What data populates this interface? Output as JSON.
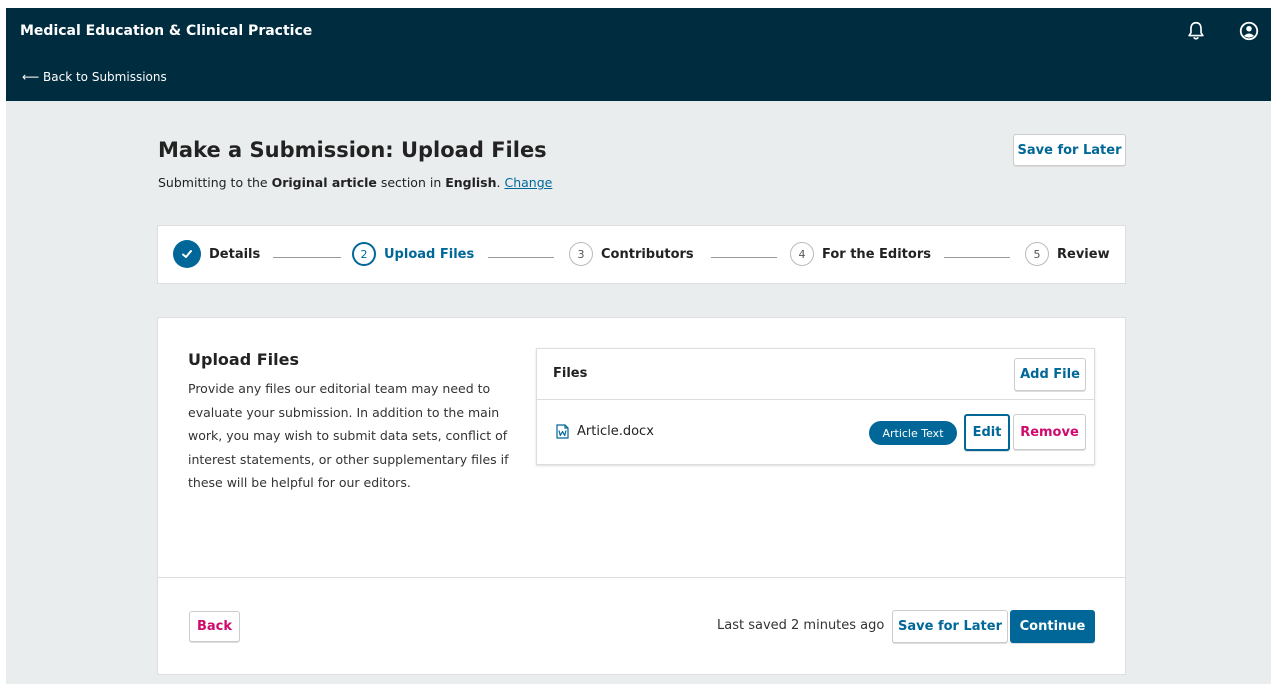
{
  "header": {
    "site_title": "Medical Education & Clinical Practice",
    "back_link": "⟵ Back to Submissions",
    "icons": [
      "bell-icon",
      "user-account-icon"
    ]
  },
  "page": {
    "title": "Make a Submission: Upload Files",
    "save_later": "Save for Later",
    "subtitle_pre": "Submitting to the ",
    "section": "Original article",
    "subtitle_mid": " section in ",
    "language": "English",
    "subtitle_post": ". ",
    "change_link": "Change"
  },
  "steps": [
    {
      "number": "",
      "label": "Details",
      "state": "complete"
    },
    {
      "number": "2",
      "label": "Upload Files",
      "state": "active"
    },
    {
      "number": "3",
      "label": "Contributors",
      "state": "pending"
    },
    {
      "number": "4",
      "label": "For the Editors",
      "state": "pending"
    },
    {
      "number": "5",
      "label": "Review",
      "state": "pending"
    }
  ],
  "upload": {
    "title": "Upload Files",
    "description": "Provide any files our editorial team may need to evaluate your submission. In addition to the main work, you may wish to submit data sets, conflict of interest statements, or other supplementary files if these will be helpful for our editors."
  },
  "files": {
    "title": "Files",
    "add_file": "Add File",
    "items": [
      {
        "name": "Article.docx",
        "type": "Article Text",
        "edit": "Edit",
        "remove": "Remove"
      }
    ]
  },
  "footer": {
    "back": "Back",
    "last_saved": "Last saved 2 minutes ago",
    "save_later": "Save for Later",
    "continue": "Continue"
  },
  "colors": {
    "header_bg": "#002c40",
    "primary": "#006798",
    "danger": "#d00a6c",
    "page_bg": "#eaedee"
  }
}
